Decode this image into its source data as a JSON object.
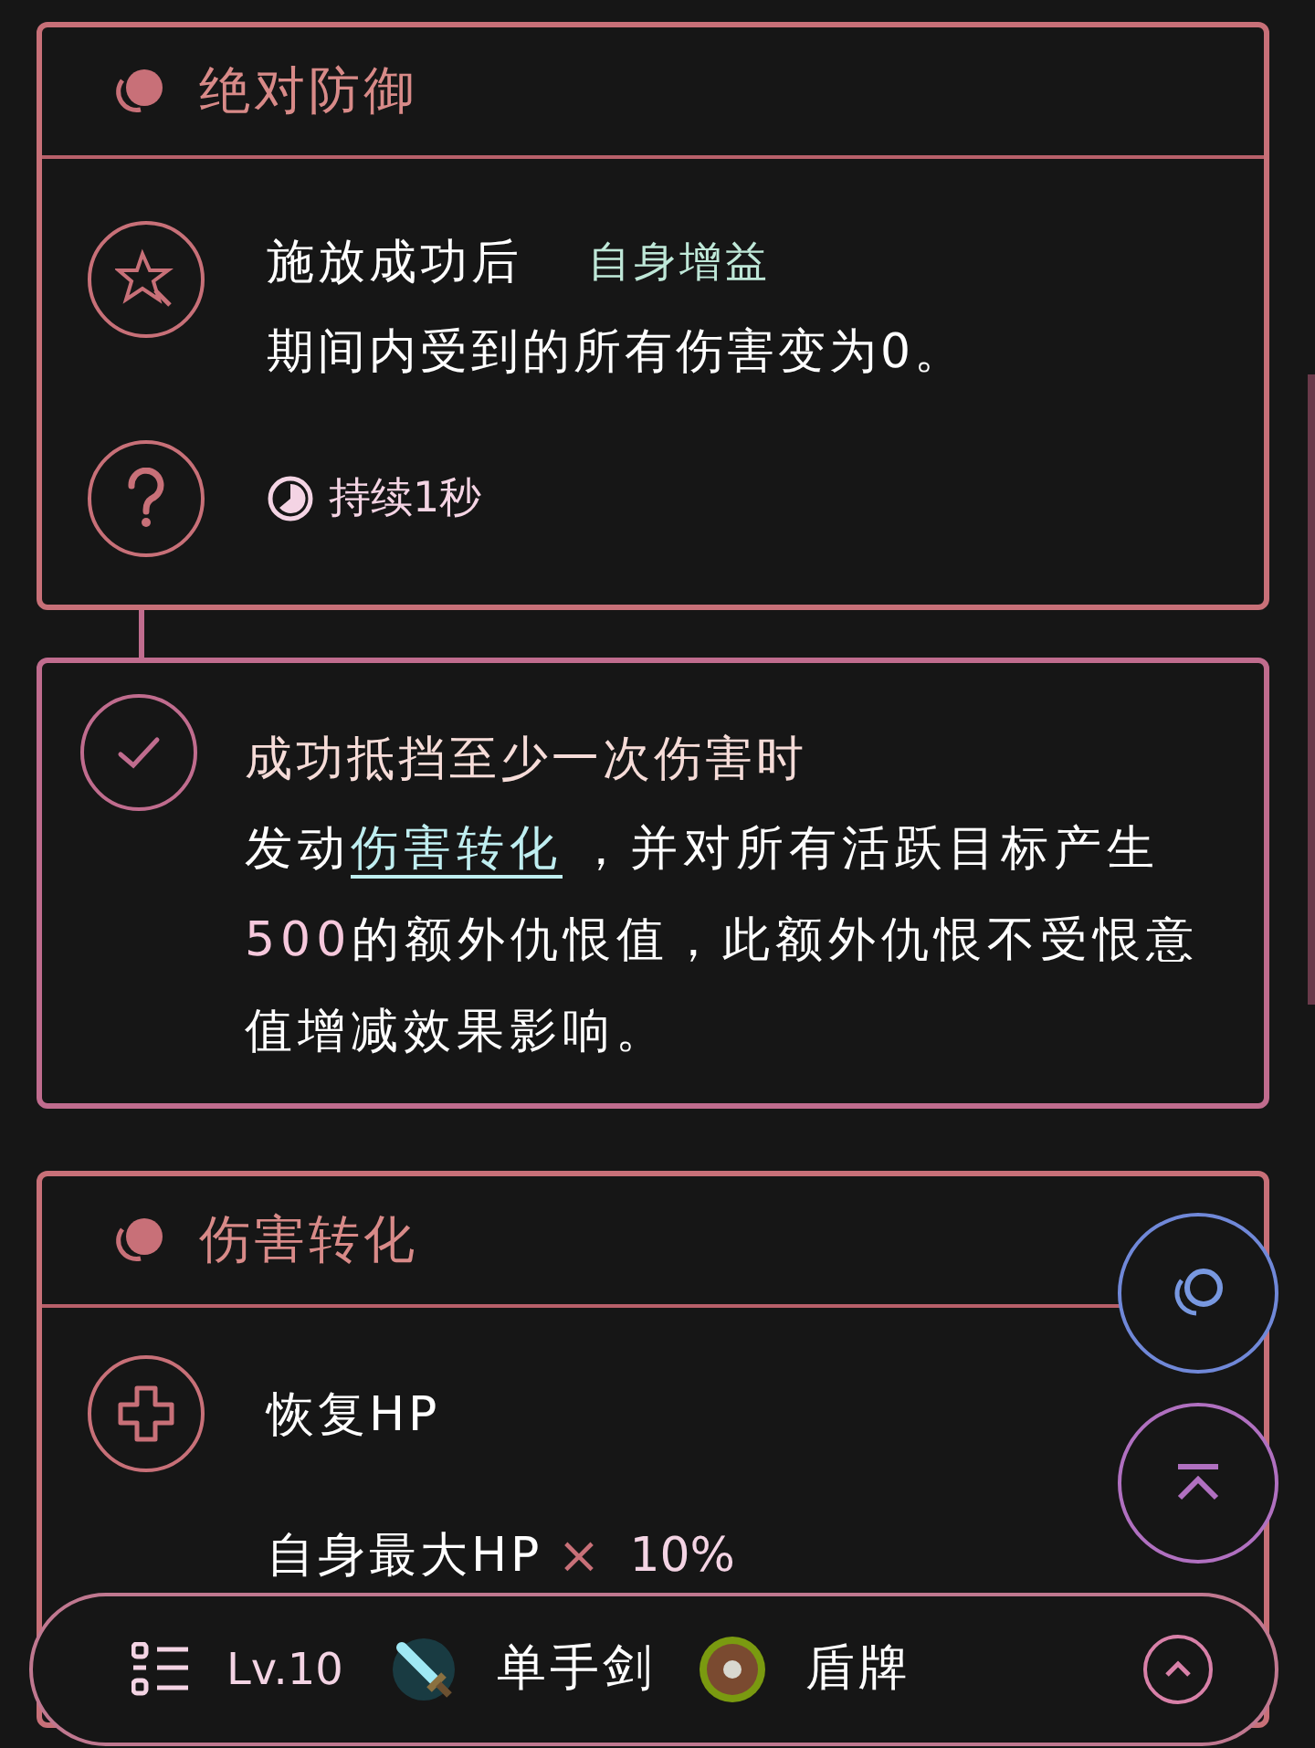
{
  "cards": [
    {
      "kind": "skill",
      "title": "绝对防御",
      "rows": [
        {
          "kind": "effect",
          "lead": "施放成功后",
          "tag": "自身增益",
          "text": "期间内受到的所有伤害变为0。"
        },
        {
          "kind": "duration",
          "text": "持续1秒"
        }
      ]
    },
    {
      "kind": "condition",
      "lead": "成功抵挡至少一次伤害时",
      "body": [
        {
          "kind": "text",
          "text": "发动"
        },
        {
          "kind": "link",
          "text": "伤害转化"
        },
        {
          "kind": "text",
          "text": "，并对所有活跃目标产生"
        },
        {
          "kind": "highlight",
          "text": "500"
        },
        {
          "kind": "text",
          "text": "的额外仇恨值，此额外仇恨不受恨意值增减效果影响。"
        }
      ]
    },
    {
      "kind": "skill",
      "title": "伤害转化",
      "rows": [
        {
          "kind": "heal",
          "lead": "恢复HP",
          "formula": [
            "自身最大HP",
            "×",
            "10%"
          ]
        }
      ]
    }
  ],
  "bottom_bar": {
    "level": "Lv.10",
    "equipment": [
      {
        "kind": "sword",
        "name": "单手剑"
      },
      {
        "kind": "shield",
        "name": "盾牌"
      }
    ]
  }
}
